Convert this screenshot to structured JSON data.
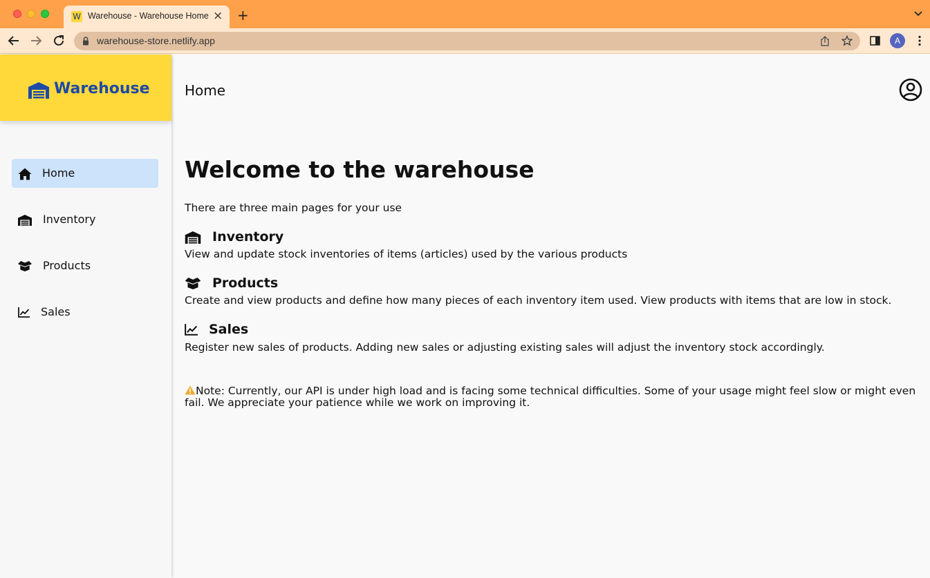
{
  "browser": {
    "tab_favicon": "W",
    "tab_title": "Warehouse - Warehouse Home",
    "url": "warehouse-store.netlify.app",
    "profile_initial": "A"
  },
  "sidebar": {
    "brand": "Warehouse",
    "items": [
      {
        "label": "Home",
        "icon": "home-icon",
        "active": true
      },
      {
        "label": "Inventory",
        "icon": "warehouse-icon"
      },
      {
        "label": "Products",
        "icon": "box-icon"
      },
      {
        "label": "Sales",
        "icon": "chart-line-icon"
      }
    ]
  },
  "main": {
    "page_title": "Home",
    "welcome": "Welcome to the warehouse",
    "intro": "There are three main pages for your use",
    "sections": [
      {
        "title": "Inventory",
        "icon": "warehouse-icon",
        "description": "View and update stock inventories of items (articles) used by the various products"
      },
      {
        "title": "Products",
        "icon": "box-icon",
        "description": "Create and view products and define how many pieces of each inventory item used. View products with items that are low in stock."
      },
      {
        "title": "Sales",
        "icon": "chart-line-icon",
        "description": "Register new sales of products. Adding new sales or adjusting existing sales will adjust the inventory stock accordingly."
      }
    ],
    "note": "Note: Currently, our API is under high load and is facing some technical difficulties. Some of your usage might feel slow or might even fail. We appreciate your patience while we work on improving it."
  },
  "colors": {
    "tabbar": "#ffa14a",
    "brand_bg": "#ffd83a",
    "brand_text": "#1d4aa5",
    "active_nav": "#cde2fb",
    "warning": "#f0a830"
  }
}
